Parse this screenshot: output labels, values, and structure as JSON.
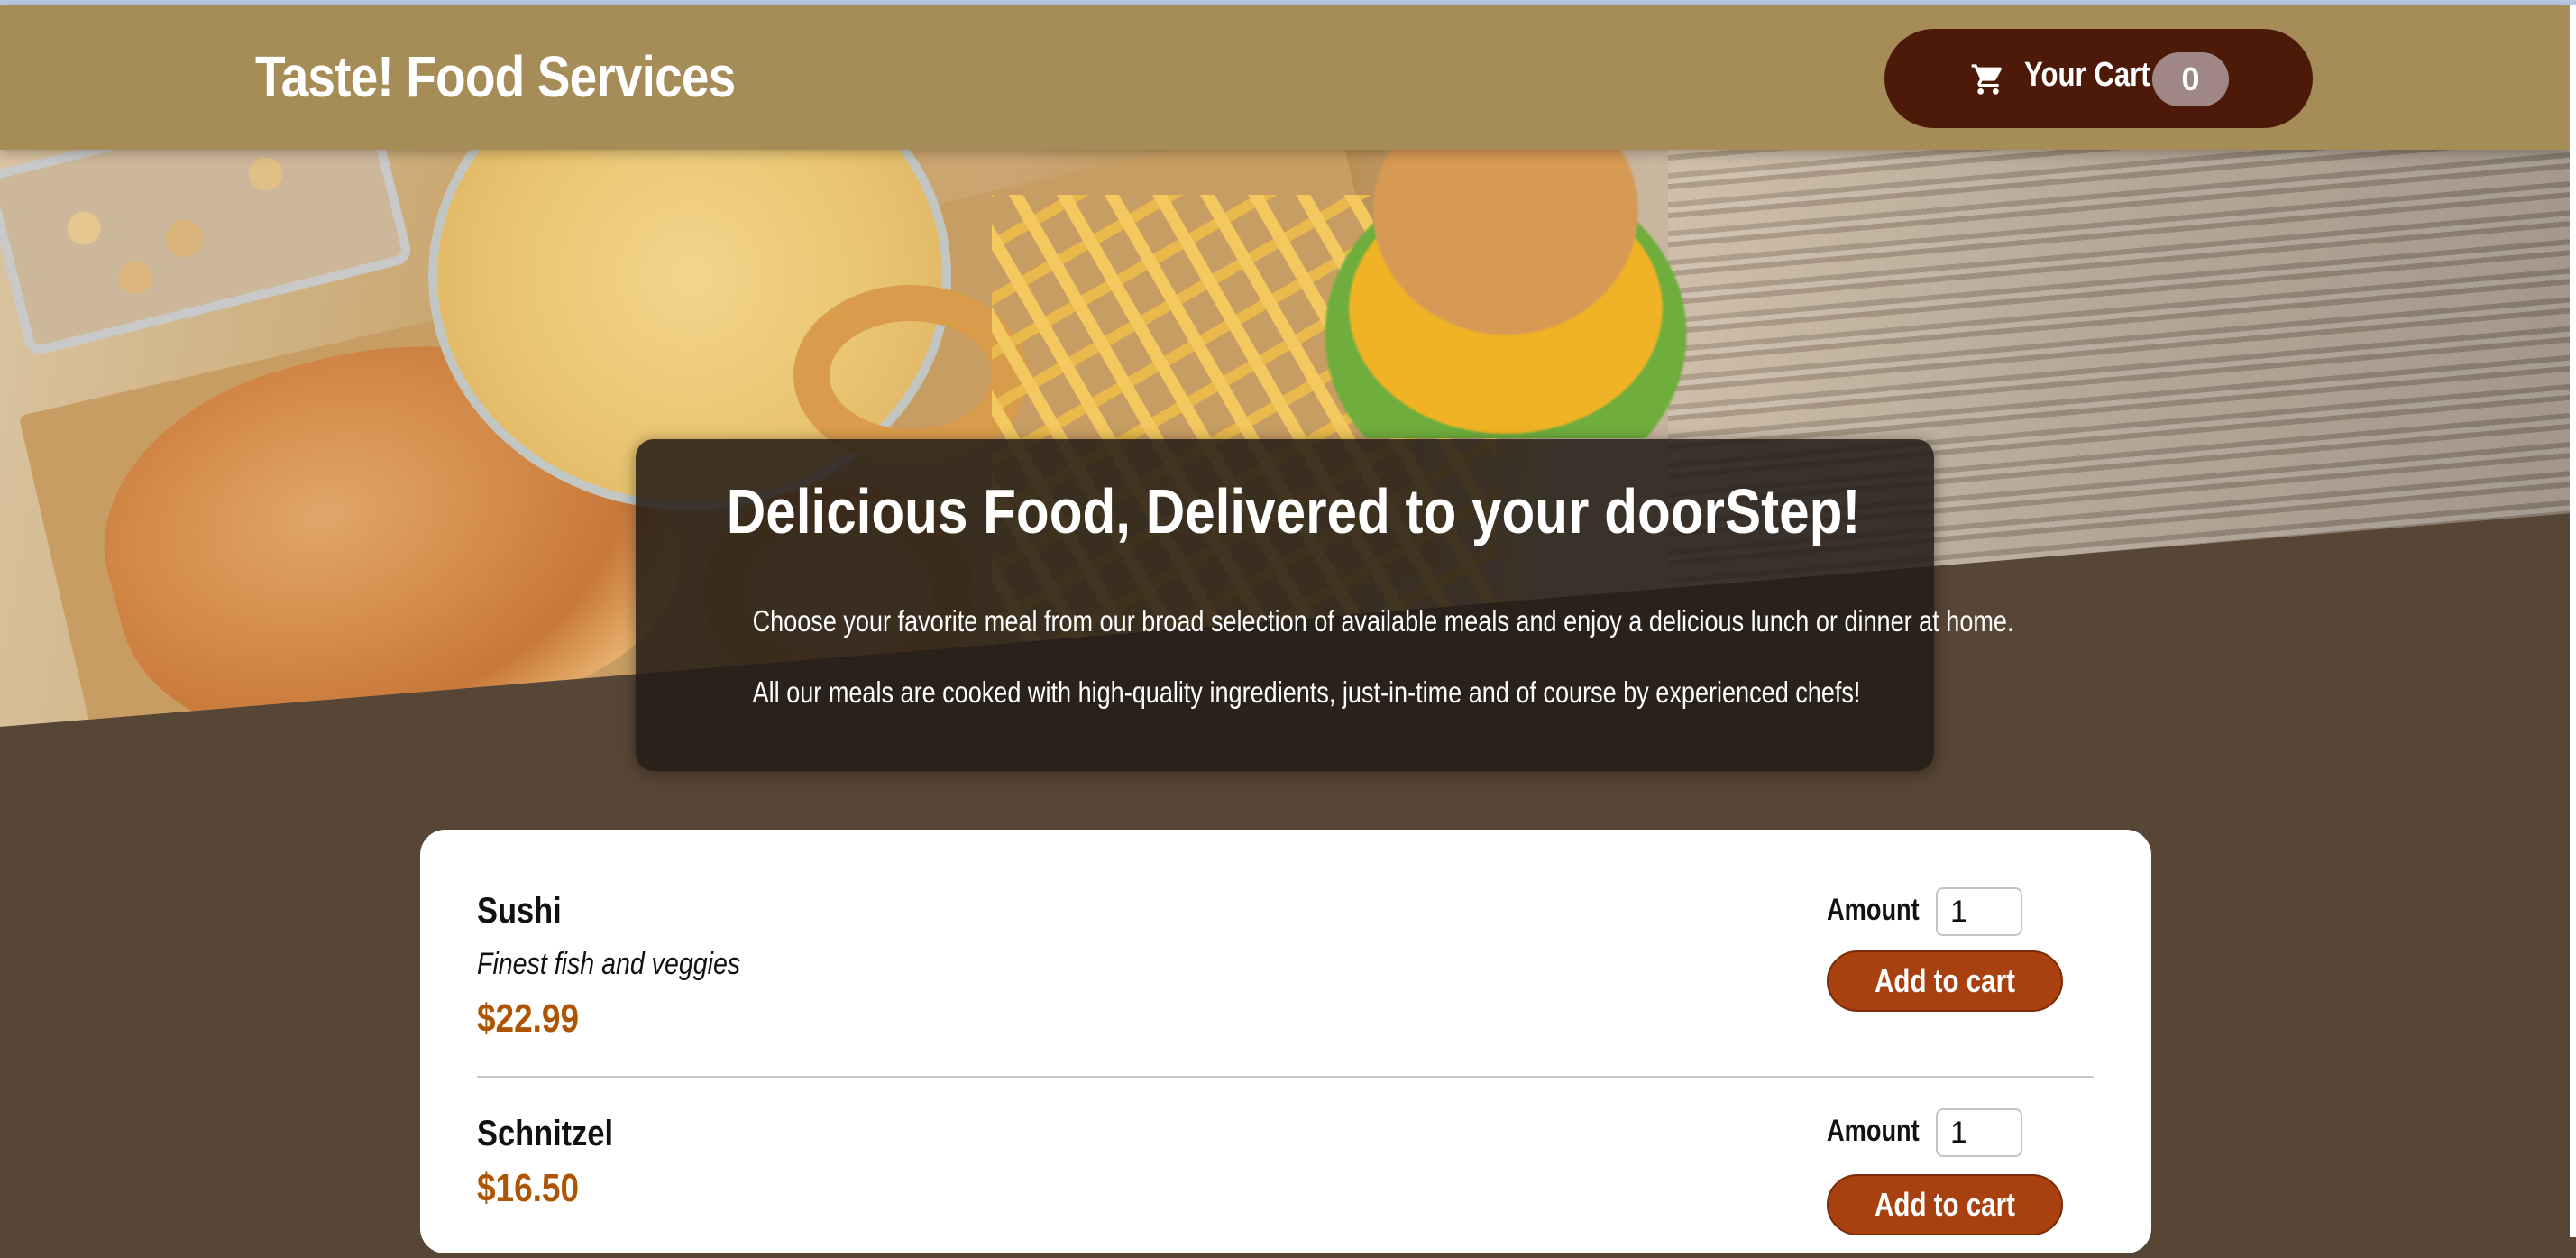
{
  "header": {
    "brand": "Taste! Food Services",
    "cart": {
      "icon": "shopping-cart-icon",
      "label": "Your Cart",
      "count": "0"
    }
  },
  "summary": {
    "title": "Delicious Food, Delivered to your doorStep!",
    "paragraph1": "Choose your favorite meal from our broad selection of available meals and enjoy a delicious lunch or dinner at home.",
    "paragraph2": "All our meals are cooked with high-quality ingredients, just-in-time and of course by experienced chefs!"
  },
  "meals": [
    {
      "name": "Sushi",
      "description": "Finest fish and veggies",
      "price": "$22.99",
      "amount_label": "Amount",
      "amount_value": "1",
      "add_label": "Add to cart"
    },
    {
      "name": "Schnitzel",
      "price": "$16.50",
      "amount_label": "Amount",
      "amount_value": "1",
      "add_label": "Add to cart"
    }
  ],
  "colors": {
    "header_bg": "#a68c56",
    "cart_button_bg": "#4d1a0a",
    "badge_bg": "#9e8784",
    "page_bg": "#574535",
    "price": "#ad5502",
    "add_button_bg": "#a8410f"
  }
}
